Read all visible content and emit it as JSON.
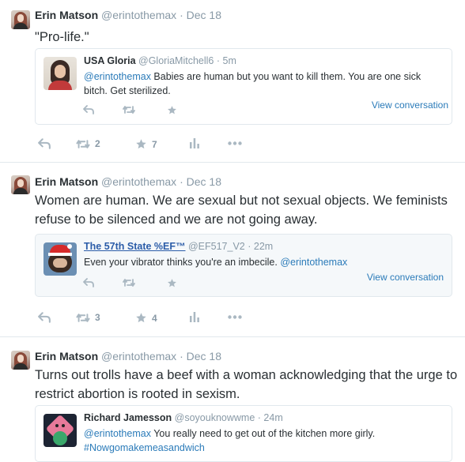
{
  "tweets": [
    {
      "name": "Erin Matson",
      "handle": "@erintothemax",
      "dot": "·",
      "time": "Dec 18",
      "text": "\"Pro-life.\"",
      "quote": {
        "name": "USA Gloria",
        "handle": "@GloriaMitchell6",
        "dot": "·",
        "time": "5m",
        "mention": "@erintothemax",
        "text": " Babies are human but you want to kill them. You are one sick bitch. Get sterilized.",
        "view": "View conversation"
      },
      "retweets": "2",
      "favorites": "7"
    },
    {
      "name": "Erin Matson",
      "handle": "@erintothemax",
      "dot": "·",
      "time": "Dec 18",
      "text": "Women are human. We are sexual but not sexual objects. We feminists refuse to be silenced and we are not going away.",
      "quote": {
        "name": "The 57th State %EF™",
        "handle": "@EF517_V2",
        "dot": "·",
        "time": "22m",
        "text": "Even your vibrator thinks you're an imbecile. ",
        "mention": "@erintothemax",
        "view": "View conversation"
      },
      "retweets": "3",
      "favorites": "4"
    },
    {
      "name": "Erin Matson",
      "handle": "@erintothemax",
      "dot": "·",
      "time": "Dec 18",
      "text": "Turns out trolls have a beef with a woman acknowledging that the urge to restrict abortion is rooted in sexism.",
      "quote": {
        "name": "Richard Jamesson",
        "handle": "@soyouknowwme",
        "dot": "·",
        "time": "24m",
        "mention": "@erintothemax",
        "text": " You really need to get out of the kitchen more girly.",
        "hashtag": "#Nowgomakemeasandwich"
      }
    }
  ],
  "icons": {
    "reply": "reply-icon",
    "retweet": "retweet-icon",
    "favorite": "star-icon",
    "analytics": "analytics-icon",
    "more": "more-icon"
  },
  "colors": {
    "link": "#2b7bb9",
    "muted": "#8899a6",
    "icon": "#aab8c2",
    "border": "#e1e8ed"
  }
}
